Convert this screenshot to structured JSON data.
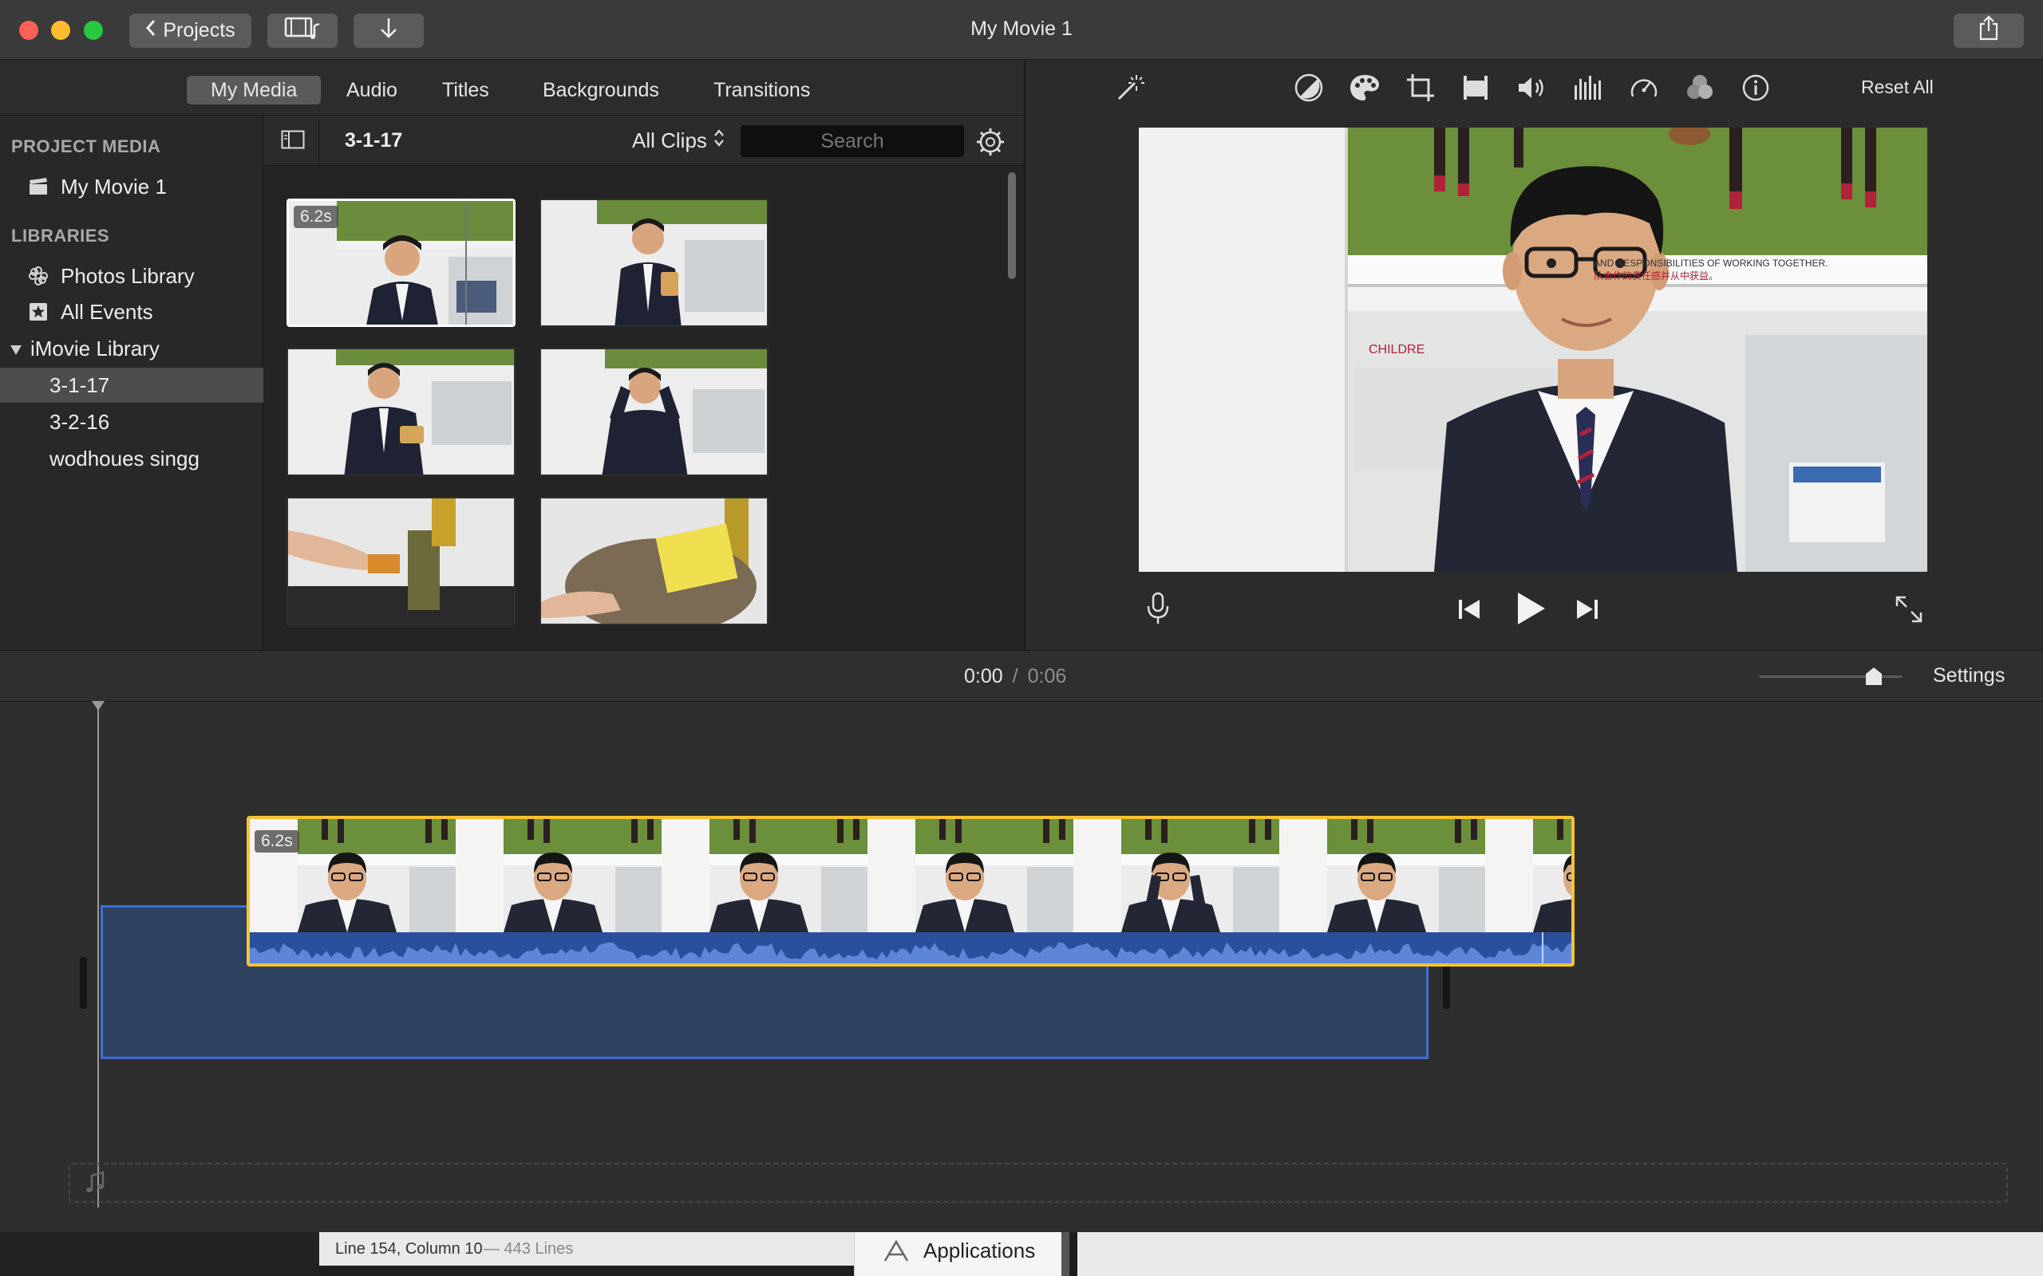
{
  "window": {
    "title": "My Movie 1"
  },
  "toolbar": {
    "projects_label": "Projects"
  },
  "browser": {
    "tabs": [
      "My Media",
      "Audio",
      "Titles",
      "Backgrounds",
      "Transitions"
    ],
    "active_tab": "My Media",
    "current_event": "3-1-17",
    "clip_filter": "All Clips",
    "search_placeholder": "Search"
  },
  "sidebar": {
    "project_media_header": "PROJECT MEDIA",
    "project_item": "My Movie 1",
    "libraries_header": "LIBRARIES",
    "photos_library": "Photos Library",
    "all_events": "All Events",
    "imovie_library": "iMovie Library",
    "events": [
      "3-1-17",
      "3-2-16",
      "wodhoues singg"
    ],
    "selected_event": "3-1-17"
  },
  "media": {
    "first_clip_duration": "6.2s"
  },
  "viewer": {
    "reset_all": "Reset All",
    "poster_text_1": "AND RESPONSIBILITIES OF WORKING TOGETHER.",
    "poster_text_2": "队合作的责任感并从中获益。",
    "poster_text_3": "CHILDRE"
  },
  "timeline": {
    "current_time": "0:00",
    "separator": "/",
    "total_time": "0:06",
    "settings_label": "Settings",
    "clip_duration": "6.2s",
    "zoom_level": 0.8
  },
  "background_windows": {
    "status_line": "Line 154, Column 10",
    "status_lines": "— 443 Lines",
    "finder_item": "Applications"
  },
  "colors": {
    "accent_yellow": "#f4c430",
    "audio_blue": "#2a4f9c",
    "selection_blue": "#3e6fd8"
  }
}
